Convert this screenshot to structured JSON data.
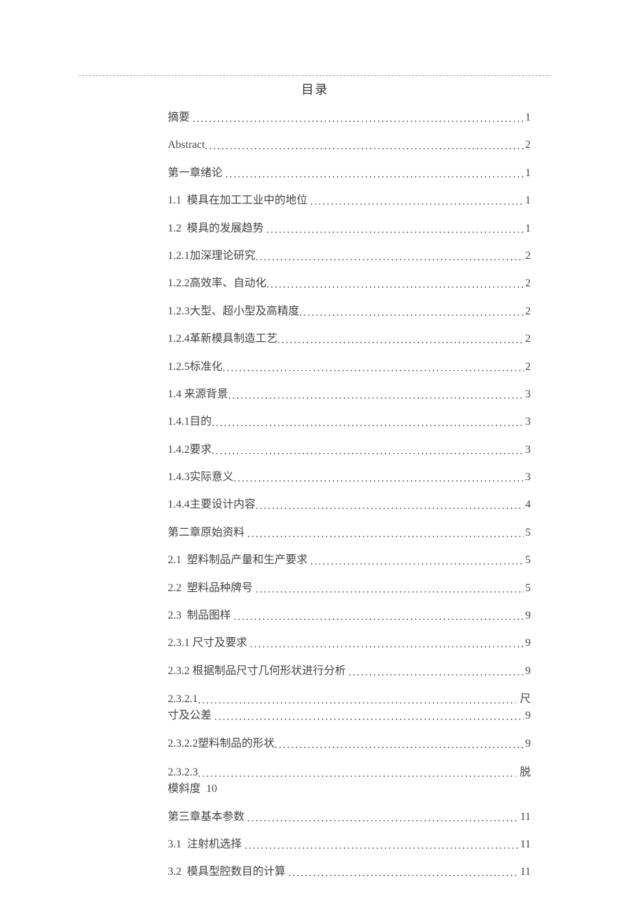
{
  "title": "目录",
  "entries": [
    {
      "label": "摘要 ",
      "page": "1",
      "type": "simple"
    },
    {
      "label": "Abstract",
      "page": "2",
      "type": "simple"
    },
    {
      "label": "第一章绪论 ",
      "page": "1",
      "type": "simple"
    },
    {
      "label": "1.1  模具在加工工业中的地位 ",
      "page": "1",
      "type": "simple"
    },
    {
      "label": "1.2  模具的发展趋势 ",
      "page": "1",
      "type": "simple"
    },
    {
      "label": "1.2.1加深理论研究",
      "page": "2",
      "type": "simple"
    },
    {
      "label": "1.2.2高效率、自动化",
      "page": "2",
      "type": "simple"
    },
    {
      "label": "1.2.3大型、超小型及高精度",
      "page": "2",
      "type": "simple"
    },
    {
      "label": "1.2.4革新模具制造工艺",
      "page": "2",
      "type": "simple"
    },
    {
      "label": "1.2.5标准化",
      "page": "2",
      "type": "simple"
    },
    {
      "label": "1.4 来源背景",
      "page": "3",
      "type": "simple"
    },
    {
      "label": "1.4.1目的",
      "page": "3",
      "type": "simple"
    },
    {
      "label": "1.4.2要求",
      "page": "3",
      "type": "simple"
    },
    {
      "label": "1.4.3实际意义",
      "page": "3",
      "type": "simple"
    },
    {
      "label": "1.4.4主要设计内容",
      "page": "4",
      "type": "simple"
    },
    {
      "label": "第二章原始资料 ",
      "page": "5",
      "type": "simple"
    },
    {
      "label": "2.1  塑料制品产量和生产要求 ",
      "page": "5",
      "type": "simple"
    },
    {
      "label": "2.2  塑料品种牌号 ",
      "page": "5",
      "type": "simple"
    },
    {
      "label": "2.3  制品图样 ",
      "page": "9",
      "type": "simple"
    },
    {
      "label": "2.3.1 尺寸及要求 ",
      "page": "9",
      "type": "simple"
    },
    {
      "label": "2.3.2 根据制品尺寸几何形状进行分析 ",
      "page": "9",
      "type": "simple"
    },
    {
      "label1": "2.3.2.1",
      "tail1": " 尺",
      "label2": "寸及公差 ",
      "page": "9",
      "type": "wrap"
    },
    {
      "label": "2.3.2.2塑料制品的形状",
      "page": "9",
      "type": "simple"
    },
    {
      "label1": "2.3.2.3",
      "tail1": " 脱",
      "label2": "模斜度  10",
      "page": "",
      "type": "wrap-nolead"
    },
    {
      "label": "第三章基本参数 ",
      "page": "11",
      "type": "simple"
    },
    {
      "label": "3.1  注射机选择 ",
      "page": "11",
      "type": "simple"
    },
    {
      "label": "3.2  模具型腔数目的计算 ",
      "page": "11",
      "type": "simple"
    }
  ]
}
